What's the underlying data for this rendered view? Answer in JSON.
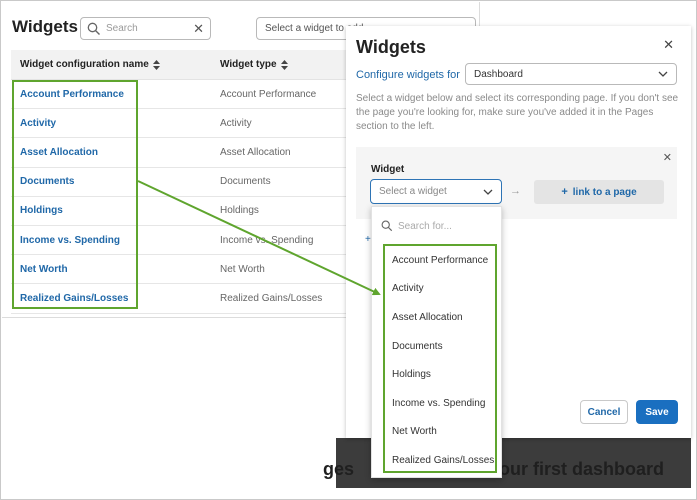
{
  "page": {
    "title": "Widgets",
    "search": {
      "placeholder": "Search",
      "value": ""
    },
    "widget_select": {
      "placeholder": "Select a widget to add"
    },
    "table": {
      "columns": [
        "Widget configuration name",
        "Widget type"
      ],
      "rows": [
        {
          "name": "Account Performance",
          "type": "Account Performance"
        },
        {
          "name": "Activity",
          "type": "Activity"
        },
        {
          "name": "Asset Allocation",
          "type": "Asset Allocation"
        },
        {
          "name": "Documents",
          "type": "Documents"
        },
        {
          "name": "Holdings",
          "type": "Holdings"
        },
        {
          "name": "Income vs. Spending",
          "type": "Income vs. Spending"
        },
        {
          "name": "Net Worth",
          "type": "Net Worth"
        },
        {
          "name": "Realized Gains/Losses",
          "type": "Realized Gains/Losses"
        }
      ]
    },
    "background_text": {
      "left": "ges",
      "right": "our first dashboard"
    }
  },
  "modal": {
    "title": "Widgets",
    "configure_label": "Configure widgets for",
    "configure_value": "Dashboard",
    "description": "Select a widget below and select its corresponding page. If you don't see the page you're looking for, make sure you've added it in the Pages section to the left.",
    "widget_label": "Widget",
    "widget_placeholder": "Select a widget",
    "link_button": "link to a page",
    "add_symbol": "+",
    "cancel": "Cancel",
    "save": "Save"
  },
  "dropdown": {
    "search_placeholder": "Search for...",
    "options": [
      "Account Performance",
      "Activity",
      "Asset Allocation",
      "Documents",
      "Holdings",
      "Income vs. Spending",
      "Net Worth",
      "Realized Gains/Losses"
    ]
  },
  "colors": {
    "link_blue": "#2068a8",
    "primary_blue": "#1a6fc0",
    "highlight_green": "#5fa52e"
  },
  "icons": {
    "search": "magnifier-icon",
    "clear": "close-icon",
    "chevron": "chevron-down-icon",
    "sort": "sort-icon",
    "arrow": "arrow-right-icon"
  }
}
